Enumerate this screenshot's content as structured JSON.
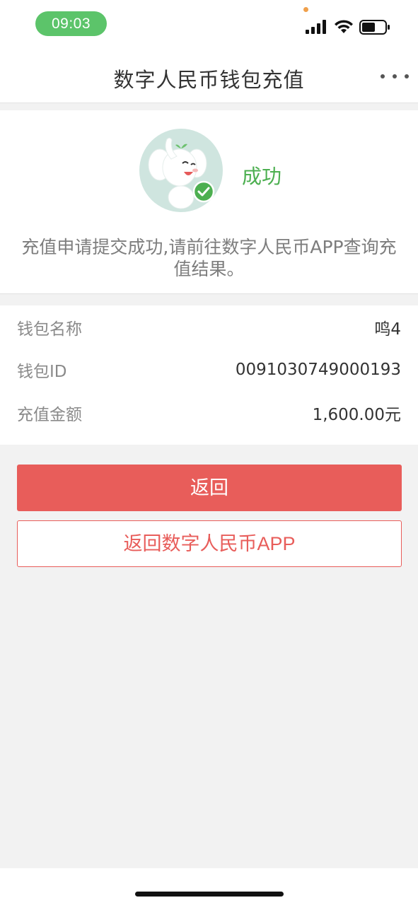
{
  "status_bar": {
    "time": "09:03",
    "icons": [
      "signal-icon",
      "wifi-icon",
      "battery-icon"
    ],
    "time_pill_color": "#5cc46a"
  },
  "nav": {
    "title": "数字人民币钱包充值",
    "more_icon": "more-dots-icon"
  },
  "result": {
    "status": "成功",
    "status_color": "#4caf50",
    "message": "充值申请提交成功,请前往数字人民币APP查询充值结果。",
    "illustration": "elephant-mascot-success"
  },
  "details": [
    {
      "label": "钱包名称",
      "value": "鸣4"
    },
    {
      "label": "钱包ID",
      "value": "0091030749000193"
    },
    {
      "label": "充值金额",
      "value": "1,600.00元"
    }
  ],
  "actions": {
    "back_label": "返回",
    "back_to_app_label": "返回数字人民币APP",
    "accent_color": "#e85d5a"
  }
}
